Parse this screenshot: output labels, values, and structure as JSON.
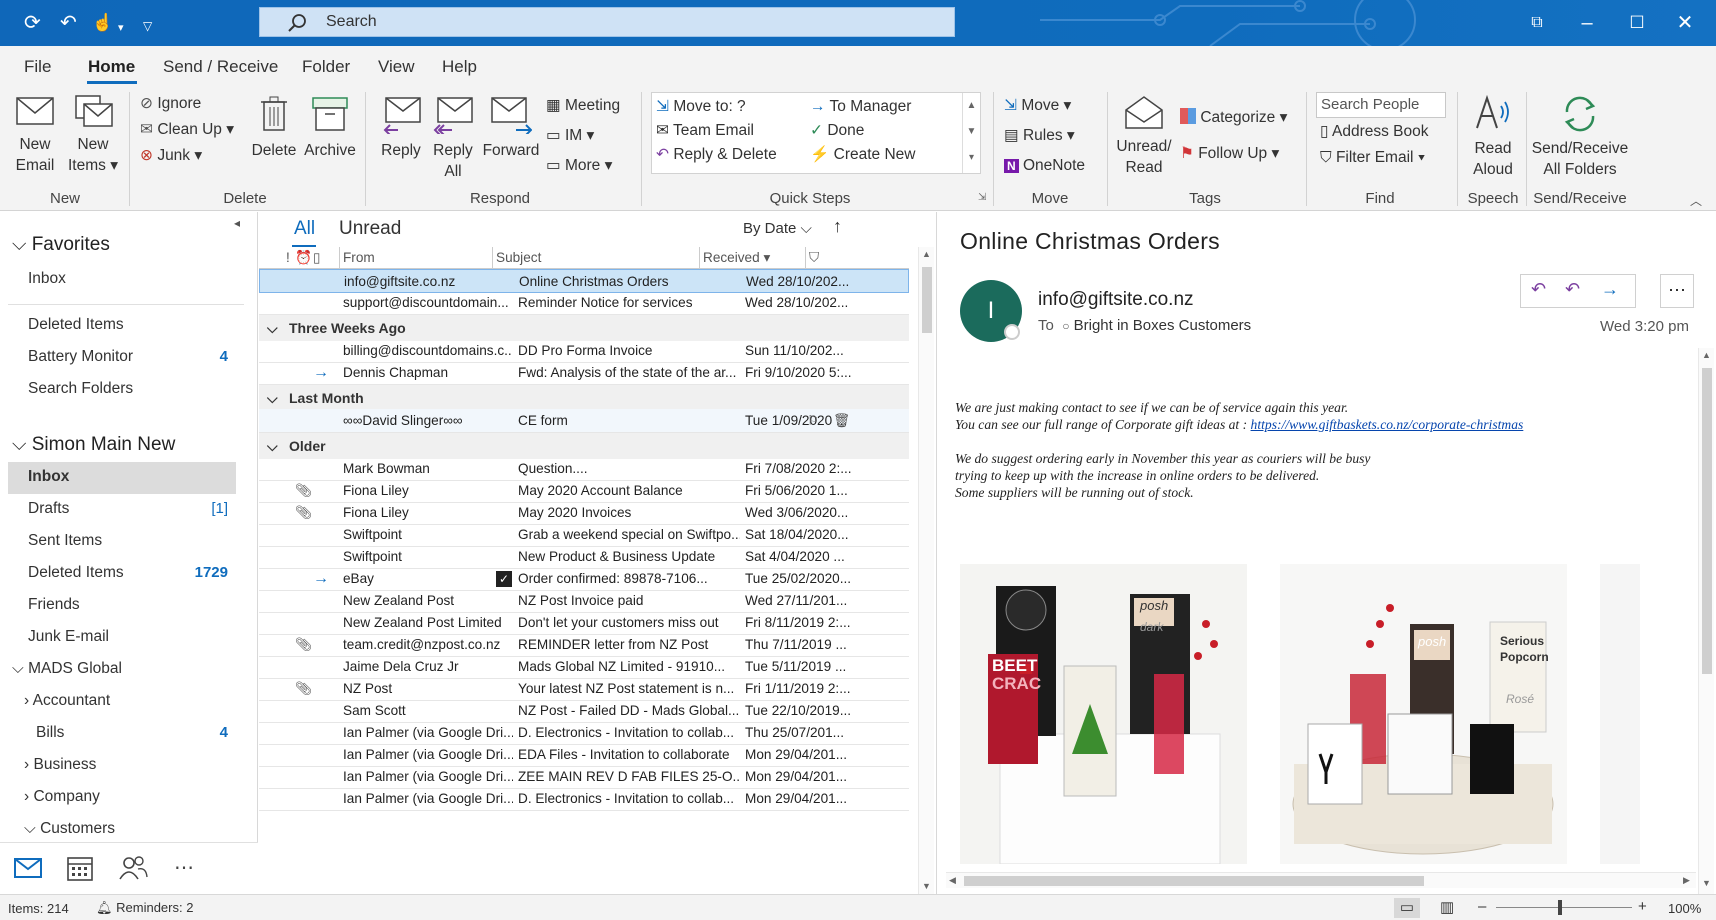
{
  "titlebar": {
    "search_placeholder": "Search"
  },
  "tabs": [
    "File",
    "Home",
    "Send / Receive",
    "Folder",
    "View",
    "Help"
  ],
  "ribbon": {
    "new_email": [
      "New",
      "Email"
    ],
    "new_items": [
      "New",
      "Items"
    ],
    "group_new": "New",
    "ignore": "Ignore",
    "clean_up": "Clean Up",
    "junk": "Junk",
    "delete": "Delete",
    "archive": "Archive",
    "group_delete": "Delete",
    "reply": "Reply",
    "reply_all": [
      "Reply",
      "All"
    ],
    "forward": "Forward",
    "meeting": "Meeting",
    "im": "IM",
    "more": "More",
    "group_respond": "Respond",
    "qs_move_to": "Move to: ?",
    "qs_team_email": "Team Email",
    "qs_reply_delete": "Reply & Delete",
    "qs_to_manager": "To Manager",
    "qs_done": "Done",
    "qs_create_new": "Create New",
    "group_quick_steps": "Quick Steps",
    "move": "Move",
    "rules": "Rules",
    "onenote": "OneNote",
    "group_move": "Move",
    "unread_read": [
      "Unread/",
      "Read"
    ],
    "categorize": "Categorize",
    "follow_up": "Follow Up",
    "group_tags": "Tags",
    "search_people": "Search People",
    "address_book": "Address Book",
    "filter_email": "Filter Email",
    "group_find": "Find",
    "read_aloud": [
      "Read",
      "Aloud"
    ],
    "group_speech": "Speech",
    "send_receive_all": [
      "Send/Receive",
      "All Folders"
    ],
    "group_send_receive": "Send/Receive"
  },
  "nav": {
    "favorites": "Favorites",
    "fav_items": [
      "Inbox"
    ],
    "extra_items": [
      {
        "label": "Deleted Items",
        "count": ""
      },
      {
        "label": "Battery Monitor",
        "count": "4"
      },
      {
        "label": "Search Folders",
        "count": ""
      }
    ],
    "account": "Simon Main New",
    "folders": [
      {
        "label": "Inbox",
        "count": ""
      },
      {
        "label": "Drafts",
        "count": "[1]"
      },
      {
        "label": "Sent Items",
        "count": ""
      },
      {
        "label": "Deleted Items",
        "count": "1729"
      },
      {
        "label": "Friends",
        "count": ""
      },
      {
        "label": "Junk E-mail",
        "count": ""
      }
    ],
    "mads": "MADS Global",
    "mads_items": [
      {
        "label": "Accountant",
        "count": ""
      },
      {
        "label": "Bills",
        "count": "4"
      },
      {
        "label": "Business",
        "count": ""
      },
      {
        "label": "Company",
        "count": ""
      },
      {
        "label": "Customers",
        "count": ""
      }
    ]
  },
  "list": {
    "filter_all": "All",
    "filter_unread": "Unread",
    "sort": "By Date",
    "col_from": "From",
    "col_subject": "Subject",
    "col_received": "Received",
    "top_rows": [
      {
        "from": "info@giftsite.co.nz",
        "subject": "Online Christmas Orders",
        "date": "Wed 28/10/202..."
      },
      {
        "from": "support@discountdomain...",
        "subject": "Reminder Notice for services",
        "date": "Wed 28/10/202..."
      }
    ],
    "group_three_weeks": "Three Weeks Ago",
    "three_weeks_rows": [
      {
        "from": "billing@discountdomains.c...",
        "subject": "DD Pro Forma Invoice",
        "date": "Sun 11/10/202..."
      },
      {
        "from": "Dennis Chapman",
        "subject": "Fwd: Analysis of the state of the ar...",
        "date": "Fri 9/10/2020 5:..."
      }
    ],
    "group_last_month": "Last Month",
    "last_month_rows": [
      {
        "from": "∞∞David Slinger∞∞",
        "subject": "CE form",
        "date": "Tue 1/09/2020 ..."
      }
    ],
    "group_older": "Older",
    "older_rows": [
      {
        "from": "Mark Bowman",
        "subject": "Question....",
        "date": "Fri 7/08/2020 2:..."
      },
      {
        "from": "Fiona Liley",
        "subject": "May 2020 Account Balance",
        "date": "Fri 5/06/2020 1..."
      },
      {
        "from": "Fiona Liley",
        "subject": "May 2020 Invoices",
        "date": "Wed 3/06/2020..."
      },
      {
        "from": "Swiftpoint",
        "subject": "Grab a weekend special on Swiftpo...",
        "date": "Sat 18/04/2020..."
      },
      {
        "from": "Swiftpoint",
        "subject": "New Product & Business Update",
        "date": "Sat 4/04/2020 ..."
      },
      {
        "from": "eBay",
        "subject": "Order confirmed: 89878-7106...",
        "date": "Tue 25/02/2020..."
      },
      {
        "from": "New Zealand Post",
        "subject": "NZ Post Invoice paid",
        "date": "Wed 27/11/201..."
      },
      {
        "from": "New Zealand Post Limited",
        "subject": "Don't let your customers miss out",
        "date": "Fri 8/11/2019 2:..."
      },
      {
        "from": "team.credit@nzpost.co.nz",
        "subject": "REMINDER letter from NZ Post",
        "date": "Thu 7/11/2019 ..."
      },
      {
        "from": "Jaime Dela Cruz Jr",
        "subject": "Mads Global NZ Limited  - 91910...",
        "date": "Tue 5/11/2019 ..."
      },
      {
        "from": "NZ Post",
        "subject": "Your latest NZ Post statement is n...",
        "date": "Fri 1/11/2019 2:..."
      },
      {
        "from": "Sam Scott",
        "subject": "NZ Post - Failed DD - Mads Global...",
        "date": "Tue 22/10/2019..."
      },
      {
        "from": "Ian Palmer (via Google Dri...",
        "subject": "D. Electronics - Invitation to collab...",
        "date": "Thu 25/07/201..."
      },
      {
        "from": "Ian Palmer (via Google Dri...",
        "subject": "EDA Files - Invitation to collaborate",
        "date": "Mon 29/04/201..."
      },
      {
        "from": "Ian Palmer (via Google Dri...",
        "subject": "ZEE MAIN REV D FAB FILES 25-O...",
        "date": "Mon 29/04/201..."
      },
      {
        "from": "Ian Palmer (via Google Dri...",
        "subject": "D. Electronics - Invitation to collab...",
        "date": "Mon 29/04/201..."
      }
    ]
  },
  "reading": {
    "subject": "Online Christmas Orders",
    "avatar_letter": "I",
    "sender": "info@giftsite.co.nz",
    "to_label": "To",
    "to": "Bright in Boxes Customers",
    "time": "Wed 3:20 pm",
    "line1": "We are just making contact to see if we can be of service again this year.",
    "line2": "You can see our full range of Corporate gift ideas at  : ",
    "link": "https://www.giftbaskets.co.nz/corporate-christmas",
    "line3": "We do suggest ordering early in November this year as couriers will be busy",
    "line4": "trying to keep up with the increase in online orders to be delivered.",
    "line5": "Some suppliers will be running out of stock.",
    "basket1_labels": [
      "BEET",
      "CRAC",
      "posh",
      "dark"
    ],
    "basket2_labels": [
      "posh",
      "Serious",
      "Popcorn",
      "Rosé"
    ]
  },
  "status": {
    "items": "Items: 214",
    "reminders": "Reminders: 2",
    "zoom": "100%"
  },
  "colors": {
    "accent": "#0f6cbd",
    "avatar": "#1b6b5c",
    "link": "#0645ad"
  }
}
